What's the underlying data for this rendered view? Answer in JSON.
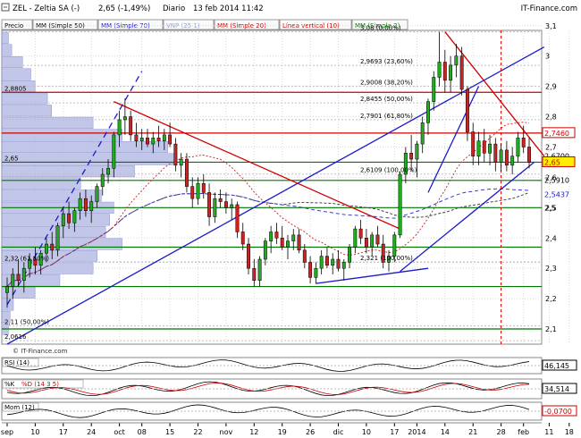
{
  "header": {
    "title": "ZEL - Zeltia SA (-)",
    "price_change": "2,65 (-1,49%)",
    "period": "Diario",
    "datetime": "13 feb 2014 11:42",
    "source": "IT-Finance.com"
  },
  "legend": [
    {
      "label": "Precio",
      "color": "#000000"
    },
    {
      "label": "MM (Simple 50)",
      "color": "#000000"
    },
    {
      "label": "MM (Simple 70)",
      "color": "#1a1acc"
    },
    {
      "label": "VNP (25 1)",
      "color": "#9aa0c8"
    },
    {
      "label": "MM (Simple 20)",
      "color": "#cc0000"
    },
    {
      "label": "Línea vertical (10)",
      "color": "#cc0000"
    },
    {
      "label": "MM (Simple 2)",
      "color": "#007700"
    }
  ],
  "watermark": "© IT-Finance.com",
  "chart_data": {
    "type": "candlestick",
    "ylim": [
      2.05,
      3.12
    ],
    "y_ticks": [
      "2,1",
      "2,2",
      "2,3",
      "2,4",
      "2,5",
      "2,6",
      "2,7",
      "2,8",
      "2,9",
      "3",
      "3,1"
    ],
    "x_ticks": [
      "sep",
      "10",
      "17",
      "24",
      "oct",
      "08",
      "15",
      "22",
      "nov",
      "12",
      "19",
      "26",
      "dic",
      "10",
      "17",
      "2014",
      "14",
      "21",
      "28",
      "feb",
      "11",
      "18"
    ],
    "price_labels": [
      {
        "text": "2,7460",
        "value": 2.746,
        "color": "#cc0000",
        "boxed": true
      },
      {
        "text": "2,6700",
        "value": 2.67,
        "color": "#000000",
        "boxed": false
      },
      {
        "text": "2,65",
        "value": 2.65,
        "color": "#cc0000",
        "boxed": true,
        "highlight": true
      },
      {
        "text": "2,5910",
        "value": 2.591,
        "color": "#000000",
        "boxed": false
      },
      {
        "text": "2,5437",
        "value": 2.5437,
        "color": "#1a1acc",
        "boxed": false
      },
      {
        "text": "2,5",
        "value": 2.5,
        "color": "#000000",
        "boxed": false
      }
    ],
    "fib_levels": [
      {
        "text": "3,08 (0,00%)",
        "value": 3.08
      },
      {
        "text": "2,9693 (23,60%)",
        "value": 2.9693
      },
      {
        "text": "2,9008 (38,20%)",
        "value": 2.9008
      },
      {
        "text": "2,8455 (50,00%)",
        "value": 2.8455
      },
      {
        "text": "2,7901 (61,80%)",
        "value": 2.7901
      },
      {
        "text": "2,6109 (100,00%)",
        "value": 2.6109
      },
      {
        "text": "2,321 (100,00%)",
        "value": 2.321
      },
      {
        "text": "2,32 (61,80%)",
        "value": 2.32
      },
      {
        "text": "2,11 (50,00%)",
        "value": 2.11
      },
      {
        "text": "2,0616",
        "value": 2.0616
      }
    ],
    "left_levels": [
      {
        "text": "2,8805",
        "value": 2.8805
      },
      {
        "text": "2,65",
        "value": 2.65
      }
    ],
    "horizontal_lines": [
      {
        "value": 2.8805,
        "color": "#cc0000"
      },
      {
        "value": 2.746,
        "color": "#cc0000"
      },
      {
        "value": 2.65,
        "color": "#007700"
      },
      {
        "value": 2.59,
        "color": "#007700"
      },
      {
        "value": 2.5,
        "color": "#007700"
      },
      {
        "value": 2.37,
        "color": "#007700"
      },
      {
        "value": 2.24,
        "color": "#007700"
      },
      {
        "value": 2.1,
        "color": "#007700"
      }
    ],
    "candles": [
      {
        "o": 2.22,
        "h": 2.27,
        "l": 2.17,
        "c": 2.24
      },
      {
        "o": 2.24,
        "h": 2.3,
        "l": 2.2,
        "c": 2.28
      },
      {
        "o": 2.28,
        "h": 2.33,
        "l": 2.24,
        "c": 2.26
      },
      {
        "o": 2.26,
        "h": 2.32,
        "l": 2.22,
        "c": 2.3
      },
      {
        "o": 2.3,
        "h": 2.35,
        "l": 2.27,
        "c": 2.33
      },
      {
        "o": 2.33,
        "h": 2.37,
        "l": 2.28,
        "c": 2.31
      },
      {
        "o": 2.31,
        "h": 2.36,
        "l": 2.28,
        "c": 2.35
      },
      {
        "o": 2.35,
        "h": 2.4,
        "l": 2.32,
        "c": 2.38
      },
      {
        "o": 2.38,
        "h": 2.42,
        "l": 2.33,
        "c": 2.36
      },
      {
        "o": 2.36,
        "h": 2.45,
        "l": 2.34,
        "c": 2.44
      },
      {
        "o": 2.44,
        "h": 2.5,
        "l": 2.4,
        "c": 2.48
      },
      {
        "o": 2.48,
        "h": 2.52,
        "l": 2.43,
        "c": 2.45
      },
      {
        "o": 2.45,
        "h": 2.5,
        "l": 2.42,
        "c": 2.49
      },
      {
        "o": 2.49,
        "h": 2.55,
        "l": 2.46,
        "c": 2.53
      },
      {
        "o": 2.53,
        "h": 2.56,
        "l": 2.47,
        "c": 2.49
      },
      {
        "o": 2.49,
        "h": 2.54,
        "l": 2.45,
        "c": 2.52
      },
      {
        "o": 2.52,
        "h": 2.58,
        "l": 2.5,
        "c": 2.57
      },
      {
        "o": 2.57,
        "h": 2.63,
        "l": 2.54,
        "c": 2.61
      },
      {
        "o": 2.61,
        "h": 2.66,
        "l": 2.58,
        "c": 2.63
      },
      {
        "o": 2.63,
        "h": 2.75,
        "l": 2.6,
        "c": 2.74
      },
      {
        "o": 2.74,
        "h": 2.82,
        "l": 2.7,
        "c": 2.79
      },
      {
        "o": 2.79,
        "h": 2.86,
        "l": 2.74,
        "c": 2.8
      },
      {
        "o": 2.8,
        "h": 2.82,
        "l": 2.72,
        "c": 2.74
      },
      {
        "o": 2.74,
        "h": 2.78,
        "l": 2.7,
        "c": 2.72
      },
      {
        "o": 2.72,
        "h": 2.76,
        "l": 2.69,
        "c": 2.73
      },
      {
        "o": 2.73,
        "h": 2.76,
        "l": 2.7,
        "c": 2.71
      },
      {
        "o": 2.71,
        "h": 2.75,
        "l": 2.68,
        "c": 2.73
      },
      {
        "o": 2.73,
        "h": 2.77,
        "l": 2.7,
        "c": 2.72
      },
      {
        "o": 2.72,
        "h": 2.76,
        "l": 2.69,
        "c": 2.74
      },
      {
        "o": 2.74,
        "h": 2.78,
        "l": 2.7,
        "c": 2.71
      },
      {
        "o": 2.71,
        "h": 2.73,
        "l": 2.62,
        "c": 2.64
      },
      {
        "o": 2.64,
        "h": 2.68,
        "l": 2.6,
        "c": 2.66
      },
      {
        "o": 2.66,
        "h": 2.68,
        "l": 2.55,
        "c": 2.57
      },
      {
        "o": 2.57,
        "h": 2.6,
        "l": 2.5,
        "c": 2.53
      },
      {
        "o": 2.53,
        "h": 2.6,
        "l": 2.51,
        "c": 2.58
      },
      {
        "o": 2.58,
        "h": 2.61,
        "l": 2.53,
        "c": 2.55
      },
      {
        "o": 2.55,
        "h": 2.58,
        "l": 2.44,
        "c": 2.47
      },
      {
        "o": 2.47,
        "h": 2.55,
        "l": 2.45,
        "c": 2.53
      },
      {
        "o": 2.53,
        "h": 2.56,
        "l": 2.5,
        "c": 2.52
      },
      {
        "o": 2.52,
        "h": 2.55,
        "l": 2.48,
        "c": 2.5
      },
      {
        "o": 2.5,
        "h": 2.53,
        "l": 2.46,
        "c": 2.51
      },
      {
        "o": 2.51,
        "h": 2.52,
        "l": 2.4,
        "c": 2.42
      },
      {
        "o": 2.42,
        "h": 2.45,
        "l": 2.36,
        "c": 2.38
      },
      {
        "o": 2.38,
        "h": 2.4,
        "l": 2.28,
        "c": 2.3
      },
      {
        "o": 2.3,
        "h": 2.33,
        "l": 2.24,
        "c": 2.26
      },
      {
        "o": 2.26,
        "h": 2.34,
        "l": 2.24,
        "c": 2.33
      },
      {
        "o": 2.33,
        "h": 2.4,
        "l": 2.31,
        "c": 2.39
      },
      {
        "o": 2.39,
        "h": 2.44,
        "l": 2.35,
        "c": 2.42
      },
      {
        "o": 2.42,
        "h": 2.45,
        "l": 2.38,
        "c": 2.4
      },
      {
        "o": 2.4,
        "h": 2.44,
        "l": 2.36,
        "c": 2.37
      },
      {
        "o": 2.37,
        "h": 2.41,
        "l": 2.33,
        "c": 2.39
      },
      {
        "o": 2.39,
        "h": 2.43,
        "l": 2.36,
        "c": 2.41
      },
      {
        "o": 2.41,
        "h": 2.43,
        "l": 2.35,
        "c": 2.36
      },
      {
        "o": 2.36,
        "h": 2.38,
        "l": 2.3,
        "c": 2.32
      },
      {
        "o": 2.32,
        "h": 2.34,
        "l": 2.25,
        "c": 2.27
      },
      {
        "o": 2.27,
        "h": 2.32,
        "l": 2.25,
        "c": 2.3
      },
      {
        "o": 2.3,
        "h": 2.36,
        "l": 2.28,
        "c": 2.34
      },
      {
        "o": 2.34,
        "h": 2.37,
        "l": 2.3,
        "c": 2.31
      },
      {
        "o": 2.31,
        "h": 2.35,
        "l": 2.28,
        "c": 2.33
      },
      {
        "o": 2.33,
        "h": 2.36,
        "l": 2.29,
        "c": 2.3
      },
      {
        "o": 2.3,
        "h": 2.33,
        "l": 2.26,
        "c": 2.32
      },
      {
        "o": 2.32,
        "h": 2.38,
        "l": 2.3,
        "c": 2.37
      },
      {
        "o": 2.37,
        "h": 2.44,
        "l": 2.35,
        "c": 2.43
      },
      {
        "o": 2.43,
        "h": 2.46,
        "l": 2.38,
        "c": 2.4
      },
      {
        "o": 2.4,
        "h": 2.43,
        "l": 2.35,
        "c": 2.37
      },
      {
        "o": 2.37,
        "h": 2.42,
        "l": 2.34,
        "c": 2.41
      },
      {
        "o": 2.41,
        "h": 2.44,
        "l": 2.37,
        "c": 2.38
      },
      {
        "o": 2.38,
        "h": 2.41,
        "l": 2.3,
        "c": 2.32
      },
      {
        "o": 2.32,
        "h": 2.36,
        "l": 2.29,
        "c": 2.34
      },
      {
        "o": 2.34,
        "h": 2.42,
        "l": 2.32,
        "c": 2.41
      },
      {
        "o": 2.41,
        "h": 2.62,
        "l": 2.4,
        "c": 2.61
      },
      {
        "o": 2.61,
        "h": 2.7,
        "l": 2.58,
        "c": 2.68
      },
      {
        "o": 2.68,
        "h": 2.74,
        "l": 2.62,
        "c": 2.66
      },
      {
        "o": 2.66,
        "h": 2.72,
        "l": 2.6,
        "c": 2.71
      },
      {
        "o": 2.71,
        "h": 2.8,
        "l": 2.68,
        "c": 2.78
      },
      {
        "o": 2.78,
        "h": 2.86,
        "l": 2.74,
        "c": 2.85
      },
      {
        "o": 2.85,
        "h": 2.95,
        "l": 2.82,
        "c": 2.93
      },
      {
        "o": 2.93,
        "h": 3.08,
        "l": 2.9,
        "c": 2.98
      },
      {
        "o": 2.98,
        "h": 3.02,
        "l": 2.88,
        "c": 2.92
      },
      {
        "o": 2.92,
        "h": 3.0,
        "l": 2.88,
        "c": 2.97
      },
      {
        "o": 2.97,
        "h": 3.04,
        "l": 2.93,
        "c": 3.0
      },
      {
        "o": 3.0,
        "h": 3.03,
        "l": 2.87,
        "c": 2.89
      },
      {
        "o": 2.89,
        "h": 2.9,
        "l": 2.72,
        "c": 2.75
      },
      {
        "o": 2.75,
        "h": 2.78,
        "l": 2.64,
        "c": 2.67
      },
      {
        "o": 2.67,
        "h": 2.75,
        "l": 2.64,
        "c": 2.72
      },
      {
        "o": 2.72,
        "h": 2.76,
        "l": 2.65,
        "c": 2.68
      },
      {
        "o": 2.68,
        "h": 2.74,
        "l": 2.64,
        "c": 2.71
      },
      {
        "o": 2.71,
        "h": 2.73,
        "l": 2.62,
        "c": 2.65
      },
      {
        "o": 2.65,
        "h": 2.71,
        "l": 2.62,
        "c": 2.69
      },
      {
        "o": 2.69,
        "h": 2.72,
        "l": 2.62,
        "c": 2.64
      },
      {
        "o": 2.64,
        "h": 2.7,
        "l": 2.61,
        "c": 2.67
      },
      {
        "o": 2.67,
        "h": 2.75,
        "l": 2.65,
        "c": 2.73
      },
      {
        "o": 2.73,
        "h": 2.77,
        "l": 2.68,
        "c": 2.7
      },
      {
        "o": 2.7,
        "h": 2.73,
        "l": 2.63,
        "c": 2.65
      }
    ],
    "volume_profile": [
      {
        "price": 2.1,
        "volume": 8
      },
      {
        "price": 2.14,
        "volume": 10
      },
      {
        "price": 2.18,
        "volume": 14
      },
      {
        "price": 2.22,
        "volume": 40
      },
      {
        "price": 2.26,
        "volume": 70
      },
      {
        "price": 2.3,
        "volume": 110
      },
      {
        "price": 2.34,
        "volume": 115
      },
      {
        "price": 2.38,
        "volume": 145
      },
      {
        "price": 2.42,
        "volume": 125
      },
      {
        "price": 2.46,
        "volume": 130
      },
      {
        "price": 2.5,
        "volume": 135
      },
      {
        "price": 2.54,
        "volume": 120
      },
      {
        "price": 2.58,
        "volume": 95
      },
      {
        "price": 2.62,
        "volume": 160
      },
      {
        "price": 2.66,
        "volume": 210
      },
      {
        "price": 2.7,
        "volume": 200
      },
      {
        "price": 2.74,
        "volume": 145
      },
      {
        "price": 2.78,
        "volume": 110
      },
      {
        "price": 2.82,
        "volume": 60
      },
      {
        "price": 2.86,
        "volume": 55
      },
      {
        "price": 2.9,
        "volume": 40
      },
      {
        "price": 2.94,
        "volume": 35
      },
      {
        "price": 2.98,
        "volume": 25
      },
      {
        "price": 3.02,
        "volume": 12
      },
      {
        "price": 3.06,
        "volume": 8
      }
    ],
    "trend_lines": [
      {
        "from": [
          0,
          2.05
        ],
        "to": [
          96,
          3.03
        ],
        "color": "#1a1acc",
        "dash": false
      },
      {
        "from": [
          0,
          2.18
        ],
        "to": [
          24,
          2.95
        ],
        "color": "#1a1acc",
        "dash": true
      },
      {
        "from": [
          19,
          2.85
        ],
        "to": [
          70,
          2.43
        ],
        "color": "#cc0000",
        "dash": false
      },
      {
        "from": [
          78,
          3.08
        ],
        "to": [
          96,
          2.67
        ],
        "color": "#cc0000",
        "dash": false
      },
      {
        "from": [
          55,
          2.25
        ],
        "to": [
          75,
          2.3
        ],
        "color": "#1a1acc",
        "dash": false
      },
      {
        "from": [
          70,
          2.29
        ],
        "to": [
          94,
          2.65
        ],
        "color": "#1a1acc",
        "dash": false
      },
      {
        "from": [
          75,
          2.55
        ],
        "to": [
          84,
          2.9
        ],
        "color": "#1a1acc",
        "dash": false
      }
    ],
    "vertical_marker": {
      "index": 88,
      "color": "#cc0000"
    }
  },
  "indicators": [
    {
      "name": "RSI (14)",
      "value": "46,145",
      "value_color": "#000000"
    },
    {
      "name": "%K",
      "name2": "%D (14 3 5)",
      "value": "34,514",
      "value_color": "#000000"
    },
    {
      "name": "Mom (12)",
      "value": "-0,0700",
      "value_color": "#cc0000"
    }
  ]
}
